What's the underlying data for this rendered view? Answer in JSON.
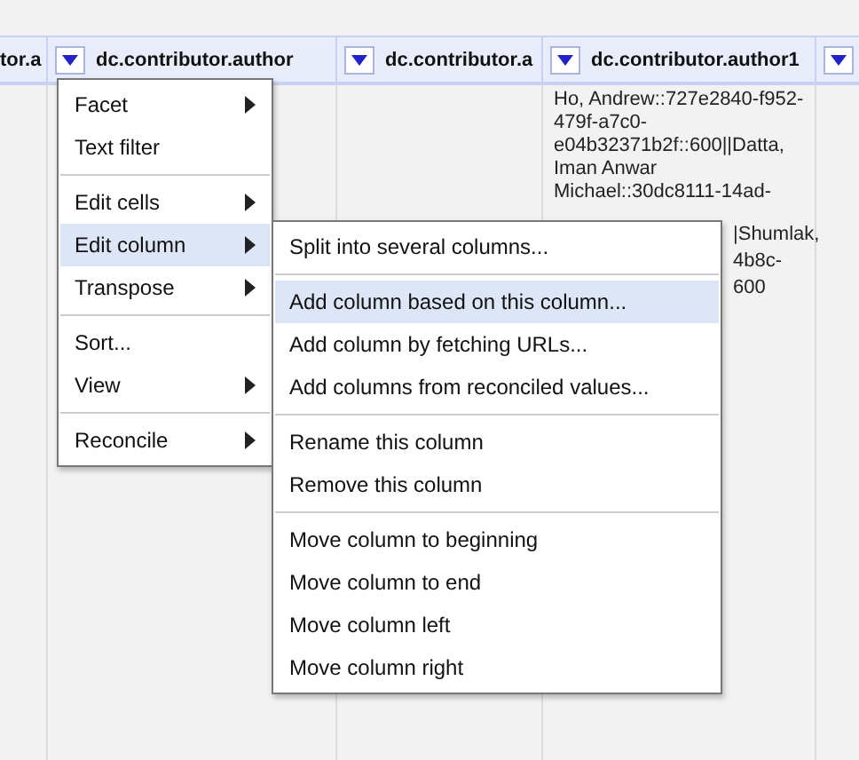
{
  "columns": [
    {
      "label": "tor.a",
      "dropdown": false
    },
    {
      "label": "dc.contributor.author",
      "dropdown": true
    },
    {
      "label": "dc.contributor.a",
      "dropdown": true
    },
    {
      "label": "dc.contributor.author1",
      "dropdown": true
    },
    {
      "dropdown": true
    }
  ],
  "cell": {
    "lines": [
      "Ho, Andrew::727e2840-f952-",
      "479f-a7c0-",
      "e04b32371b2f::600||Datta,",
      "Iman Anwar",
      "Michael::30dc8111-14ad-"
    ],
    "fragments": [
      "|Shumlak,",
      "4b8c-",
      "600"
    ]
  },
  "menu": [
    {
      "kind": "item",
      "label": "Facet",
      "submenu": true,
      "selected": false
    },
    {
      "kind": "item",
      "label": "Text filter",
      "submenu": false,
      "selected": false
    },
    {
      "kind": "separator"
    },
    {
      "kind": "item",
      "label": "Edit cells",
      "submenu": true,
      "selected": false
    },
    {
      "kind": "item",
      "label": "Edit column",
      "submenu": true,
      "selected": true
    },
    {
      "kind": "item",
      "label": "Transpose",
      "submenu": true,
      "selected": false
    },
    {
      "kind": "separator"
    },
    {
      "kind": "item",
      "label": "Sort...",
      "submenu": false,
      "selected": false
    },
    {
      "kind": "item",
      "label": "View",
      "submenu": true,
      "selected": false
    },
    {
      "kind": "separator"
    },
    {
      "kind": "item",
      "label": "Reconcile",
      "submenu": true,
      "selected": false
    }
  ],
  "submenu": [
    {
      "kind": "item",
      "label": "Split into several columns...",
      "selected": false
    },
    {
      "kind": "separator"
    },
    {
      "kind": "item",
      "label": "Add column based on this column...",
      "selected": true
    },
    {
      "kind": "item",
      "label": "Add column by fetching URLs...",
      "selected": false
    },
    {
      "kind": "item",
      "label": "Add columns from reconciled values...",
      "selected": false
    },
    {
      "kind": "separator"
    },
    {
      "kind": "item",
      "label": "Rename this column",
      "selected": false
    },
    {
      "kind": "item",
      "label": "Remove this column",
      "selected": false
    },
    {
      "kind": "separator"
    },
    {
      "kind": "item",
      "label": "Move column to beginning",
      "selected": false
    },
    {
      "kind": "item",
      "label": "Move column to end",
      "selected": false
    },
    {
      "kind": "item",
      "label": "Move column left",
      "selected": false
    },
    {
      "kind": "item",
      "label": "Move column right",
      "selected": false
    }
  ]
}
